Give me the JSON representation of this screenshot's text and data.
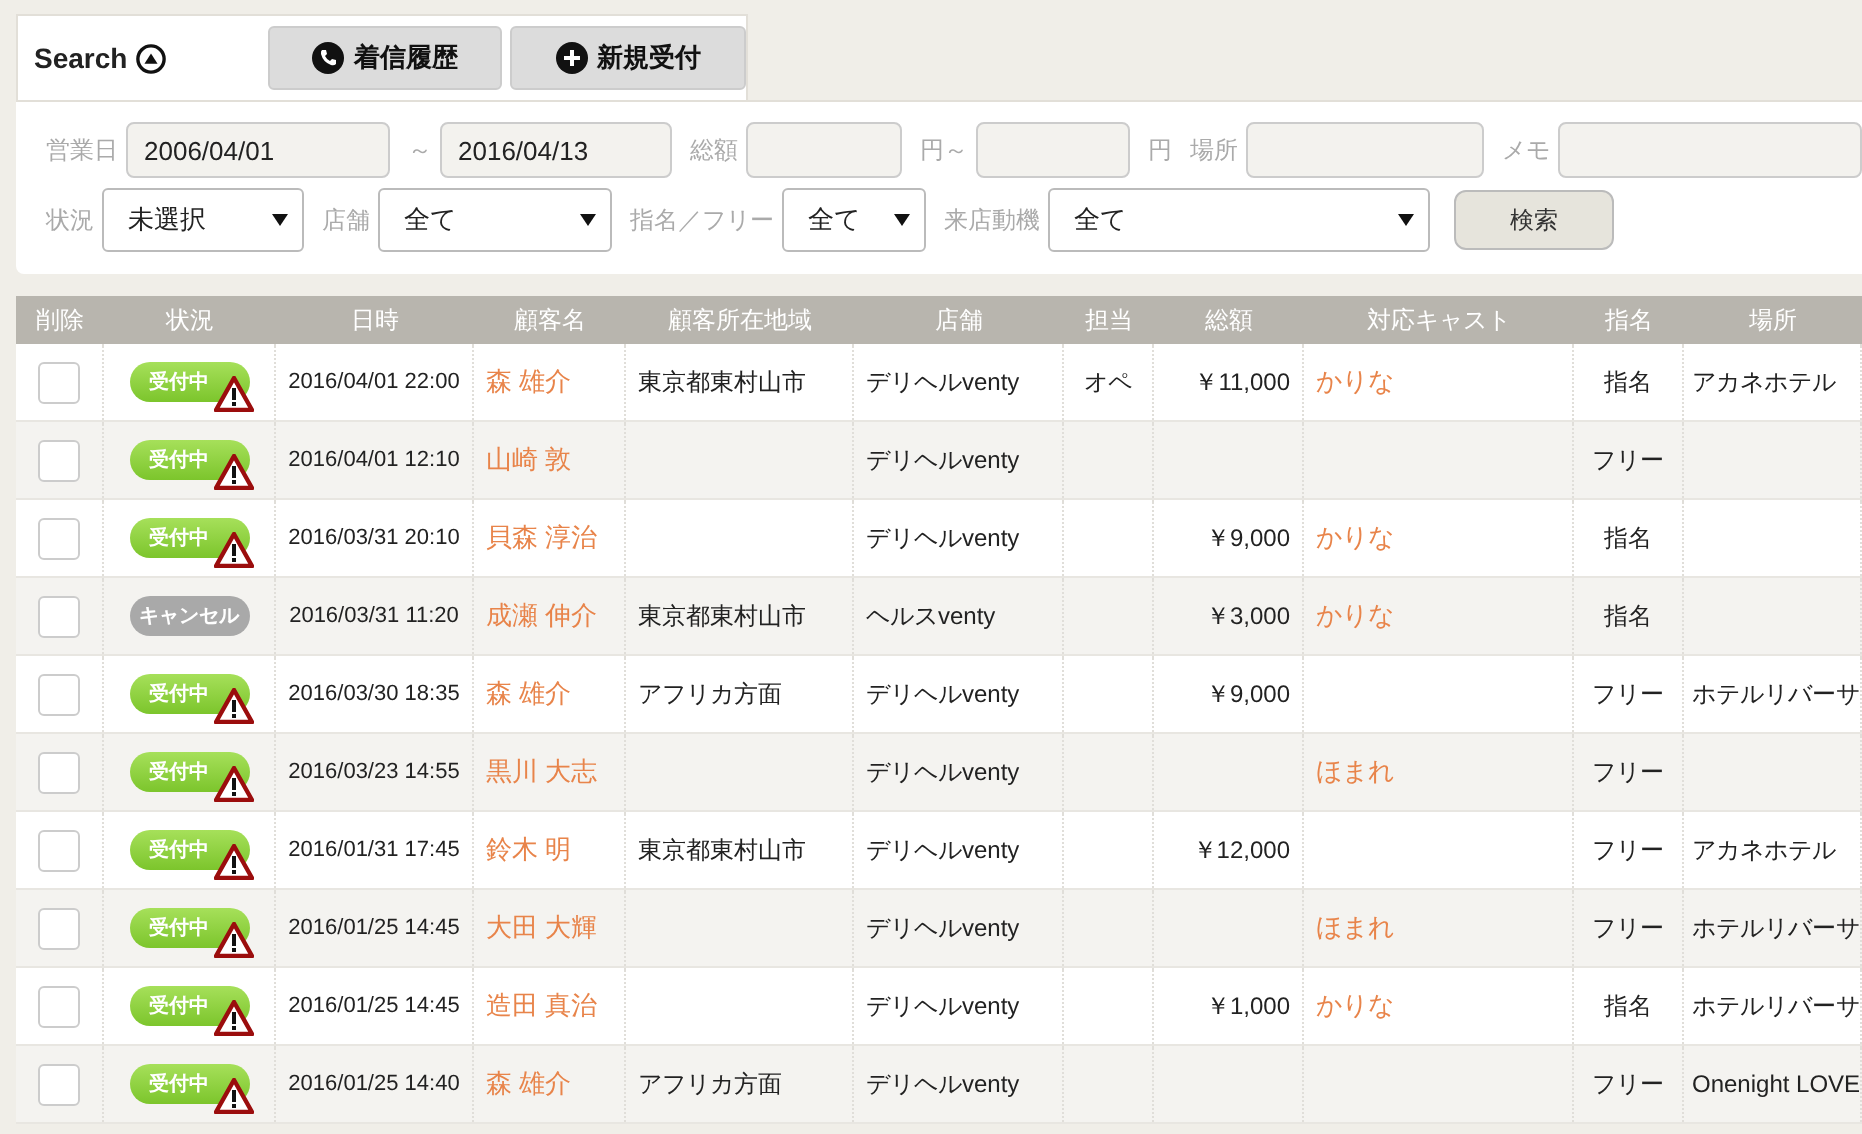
{
  "search": {
    "title": "Search",
    "expanded": true,
    "actions": [
      {
        "label": "着信履歴"
      },
      {
        "label": "新規受付"
      }
    ],
    "filter_rows": [
      [
        {
          "kind": "label",
          "text": "営業日"
        },
        {
          "kind": "input",
          "value": "2006/04/01"
        },
        {
          "kind": "label",
          "text": "～"
        },
        {
          "kind": "input",
          "value": "2016/04/13"
        },
        {
          "kind": "label",
          "text": "総額"
        },
        {
          "kind": "input"
        },
        {
          "kind": "label",
          "text": "円～"
        },
        {
          "kind": "input"
        },
        {
          "kind": "label",
          "text": "円"
        },
        {
          "kind": "label",
          "text": "場所"
        },
        {
          "kind": "input"
        },
        {
          "kind": "label",
          "text": "メモ"
        },
        {
          "kind": "input"
        }
      ],
      [
        {
          "kind": "label",
          "text": "状況"
        },
        {
          "kind": "select",
          "value": "未選択"
        },
        {
          "kind": "label",
          "text": "店舗"
        },
        {
          "kind": "select",
          "value": "全て"
        },
        {
          "kind": "label",
          "text": "指名／フリー"
        },
        {
          "kind": "select",
          "value": "全て"
        },
        {
          "kind": "label",
          "text": "来店動機"
        },
        {
          "kind": "select",
          "value": "全て"
        },
        {
          "kind": "button",
          "text": "検索"
        }
      ]
    ]
  },
  "table": {
    "columns": [
      "削除",
      "状況",
      "日時",
      "顧客名",
      "顧客所在地域",
      "店舗",
      "担当",
      "総額",
      "対応キャスト",
      "指名",
      "場所"
    ],
    "rows": [
      {
        "checked": false,
        "status": {
          "kind": "accepted",
          "label": "受付中",
          "warning": true
        },
        "datetime": "2016/04/01 22:00",
        "customer": "森 雄介",
        "area": "東京都東村山市",
        "store": "デリヘルventy",
        "staff": "オペ",
        "total": "￥11,000",
        "cast": "かりな",
        "nomination": "指名",
        "place": "アカネホテル"
      },
      {
        "checked": false,
        "status": {
          "kind": "accepted",
          "label": "受付中",
          "warning": true
        },
        "datetime": "2016/04/01 12:10",
        "customer": "山崎 敦",
        "area": "",
        "store": "デリヘルventy",
        "staff": "",
        "total": "",
        "cast": "",
        "nomination": "フリー",
        "place": ""
      },
      {
        "checked": false,
        "status": {
          "kind": "accepted",
          "label": "受付中",
          "warning": true
        },
        "datetime": "2016/03/31 20:10",
        "customer": "貝森 淳治",
        "area": "",
        "store": "デリヘルventy",
        "staff": "",
        "total": "￥9,000",
        "cast": "かりな",
        "nomination": "指名",
        "place": ""
      },
      {
        "checked": false,
        "status": {
          "kind": "cancelled",
          "label": "キャンセル",
          "warning": false
        },
        "datetime": "2016/03/31 11:20",
        "customer": "成瀬 伸介",
        "area": "東京都東村山市",
        "store": "ヘルスventy",
        "staff": "",
        "total": "￥3,000",
        "cast": "かりな",
        "nomination": "指名",
        "place": ""
      },
      {
        "checked": false,
        "status": {
          "kind": "accepted",
          "label": "受付中",
          "warning": true
        },
        "datetime": "2016/03/30 18:35",
        "customer": "森 雄介",
        "area": "アフリカ方面",
        "store": "デリヘルventy",
        "staff": "",
        "total": "￥9,000",
        "cast": "",
        "nomination": "フリー",
        "place": "ホテルリバーサ"
      },
      {
        "checked": false,
        "status": {
          "kind": "accepted",
          "label": "受付中",
          "warning": true
        },
        "datetime": "2016/03/23 14:55",
        "customer": "黒川 大志",
        "area": "",
        "store": "デリヘルventy",
        "staff": "",
        "total": "",
        "cast": "ほまれ",
        "nomination": "フリー",
        "place": ""
      },
      {
        "checked": false,
        "status": {
          "kind": "accepted",
          "label": "受付中",
          "warning": true
        },
        "datetime": "2016/01/31 17:45",
        "customer": "鈴木 明",
        "area": "東京都東村山市",
        "store": "デリヘルventy",
        "staff": "",
        "total": "￥12,000",
        "cast": "",
        "nomination": "フリー",
        "place": "アカネホテル"
      },
      {
        "checked": false,
        "status": {
          "kind": "accepted",
          "label": "受付中",
          "warning": true
        },
        "datetime": "2016/01/25 14:45",
        "customer": "大田 大輝",
        "area": "",
        "store": "デリヘルventy",
        "staff": "",
        "total": "",
        "cast": "ほまれ",
        "nomination": "フリー",
        "place": "ホテルリバーサ"
      },
      {
        "checked": false,
        "status": {
          "kind": "accepted",
          "label": "受付中",
          "warning": true
        },
        "datetime": "2016/01/25 14:45",
        "customer": "造田 真治",
        "area": "",
        "store": "デリヘルventy",
        "staff": "",
        "total": "￥1,000",
        "cast": "かりな",
        "nomination": "指名",
        "place": "ホテルリバーサ"
      },
      {
        "checked": false,
        "status": {
          "kind": "accepted",
          "label": "受付中",
          "warning": true
        },
        "datetime": "2016/01/25 14:40",
        "customer": "森 雄介",
        "area": "アフリカ方面",
        "store": "デリヘルventy",
        "staff": "",
        "total": "",
        "cast": "",
        "nomination": "フリー",
        "place": "Onenight LOVE"
      }
    ]
  }
}
